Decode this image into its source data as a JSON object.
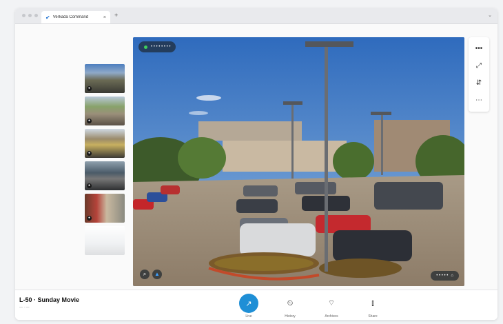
{
  "browser": {
    "tab_title": "Verkada Command",
    "tab_close": "×",
    "new_tab": "+",
    "tab_menu": "⌄"
  },
  "thumbnails": [
    {
      "name": "camera-1"
    },
    {
      "name": "camera-2"
    },
    {
      "name": "camera-3"
    },
    {
      "name": "camera-4"
    },
    {
      "name": "camera-5"
    },
    {
      "name": "camera-6"
    }
  ],
  "viewer": {
    "live_label": "• • • • • • • •",
    "zoom_out": "⌕",
    "zoom_up": "▲",
    "snapshot_label": "• • • • •",
    "snapshot_icon": "⌂"
  },
  "rail": {
    "icons": [
      "•••",
      "⤢",
      "⇵",
      "⋯"
    ]
  },
  "camera": {
    "title": "L-50 · Sunday Movie",
    "subtitle": "— · —"
  },
  "actions": [
    {
      "icon": "↗",
      "label": "Live"
    },
    {
      "icon": "⏲",
      "label": "History"
    },
    {
      "icon": "⌔",
      "label": "Archives"
    },
    {
      "icon": "⫾",
      "label": "Share"
    }
  ],
  "colors": {
    "accent": "#1f8fd6",
    "live_dot": "#3ecf5c"
  }
}
